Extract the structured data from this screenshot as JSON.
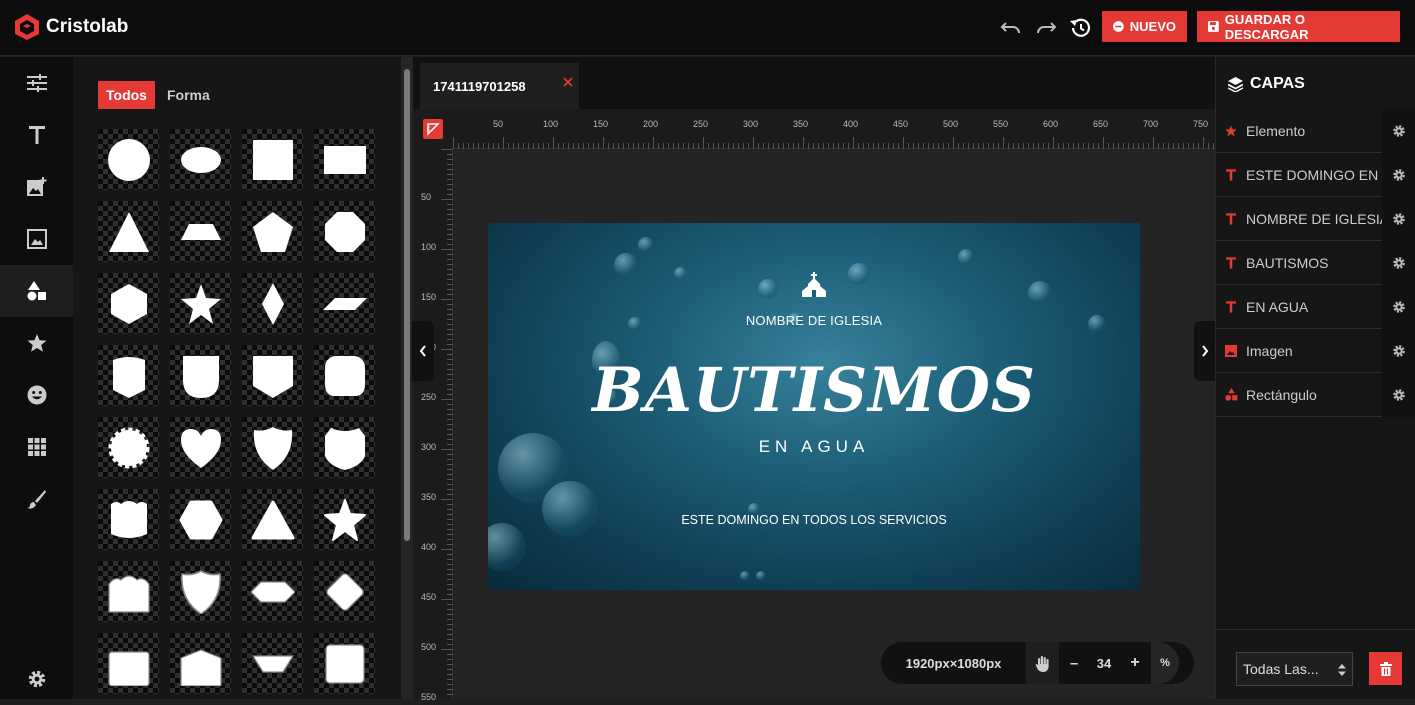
{
  "app": {
    "brand": "Cristolab",
    "accent": "#e53935"
  },
  "toolbar": {
    "nuevo_label": "NUEVO",
    "guardar_label": "GUARDAR O DESCARGAR"
  },
  "side_icons": [
    "sliders-icon",
    "text-icon",
    "add-image-icon",
    "image-frame-icon",
    "shapes-icon",
    "star-icon",
    "emoji-icon",
    "grid-icon",
    "brush-icon",
    "settings-icon"
  ],
  "shapes_panel": {
    "tabs": [
      {
        "label": "Todos",
        "active": true
      },
      {
        "label": "Forma",
        "active": false
      }
    ]
  },
  "document": {
    "tab_name": "1741119701258"
  },
  "rulers": {
    "h": [
      "50",
      "100",
      "150",
      "200",
      "250",
      "300",
      "350",
      "400",
      "450",
      "500",
      "550",
      "600",
      "650",
      "700",
      "750"
    ],
    "v": [
      "50",
      "100",
      "150",
      "200",
      "250",
      "300",
      "350",
      "400",
      "450",
      "500",
      "550"
    ]
  },
  "canvas": {
    "church_name": "NOMBRE DE IGLESIA",
    "headline": "BAUTISMOS",
    "subline": "EN AGUA",
    "footer": "ESTE DOMINGO EN TODOS LOS SERVICIOS"
  },
  "zoom": {
    "dimensions": "1920px×1080px",
    "minus": "–",
    "value": "34",
    "plus": "+",
    "unit": "%"
  },
  "layers": {
    "title": "CAPAS",
    "items": [
      {
        "label": "Elemento",
        "type": "star-icon"
      },
      {
        "label": "ESTE DOMINGO EN TODOS LOS SERVICIOS",
        "type": "text-icon"
      },
      {
        "label": "NOMBRE DE IGLESIA",
        "type": "text-icon"
      },
      {
        "label": "BAUTISMOS",
        "type": "text-icon"
      },
      {
        "label": "EN AGUA",
        "type": "text-icon"
      },
      {
        "label": "Imagen",
        "type": "image-icon"
      },
      {
        "label": "Rectángulo",
        "type": "shapes-icon"
      }
    ],
    "filter_value": "Todas Las..."
  }
}
